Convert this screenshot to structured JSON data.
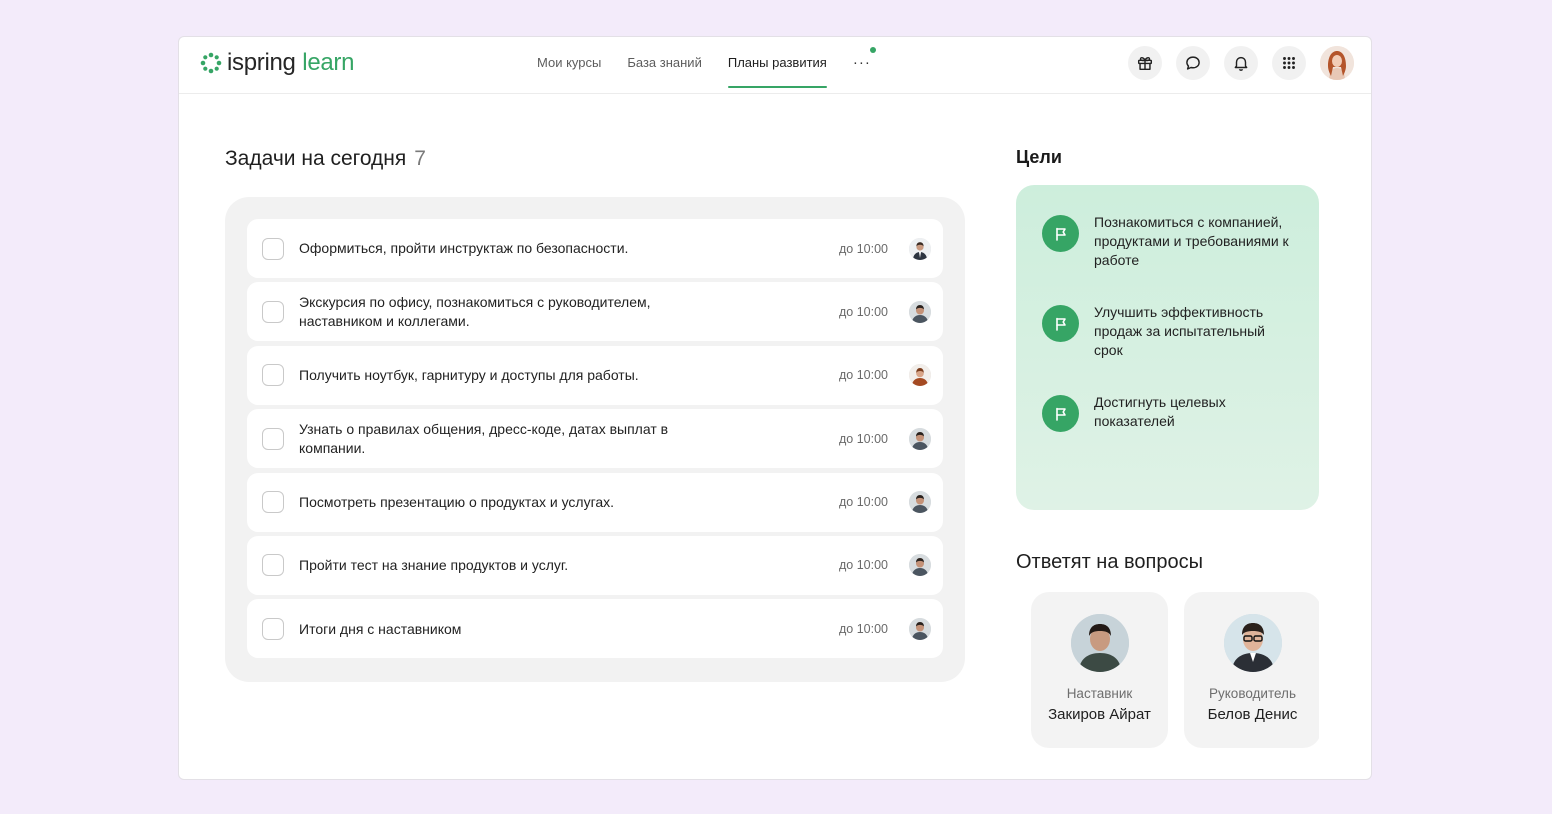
{
  "brand": {
    "word1": "ispring",
    "word2": "learn"
  },
  "nav": {
    "items": [
      "Мои курсы",
      "База знаний",
      "Планы развития"
    ],
    "active_index": 2,
    "more_label": "···"
  },
  "header_icons": [
    "gift-icon",
    "chat-icon",
    "bell-icon",
    "apps-grid-icon"
  ],
  "tasks": {
    "title": "Задачи на сегодня",
    "count": "7",
    "items": [
      {
        "text": "Оформиться, пройти инструктаж по безопасности.",
        "due": "до 10:00"
      },
      {
        "text": "Экскурсия по офису, познакомиться с руководителем, наставником и коллегами.",
        "due": "до 10:00"
      },
      {
        "text": "Получить ноутбук, гарнитуру и доступы для работы.",
        "due": "до 10:00"
      },
      {
        "text": "Узнать о правилах общения, дресс-коде, датах выплат в компании.",
        "due": "до 10:00"
      },
      {
        "text": "Посмотреть презентацию о продуктах и услугах.",
        "due": "до 10:00"
      },
      {
        "text": "Пройти тест на знание продуктов и услуг.",
        "due": "до 10:00"
      },
      {
        "text": "Итоги дня с наставником",
        "due": "до 10:00"
      }
    ]
  },
  "goals": {
    "title": "Цели",
    "items": [
      "Познакомиться с компанией, продуктами и требованиями к работе",
      "Улучшить эффективность продаж за испытательный срок",
      "Достигнуть целевых показателей"
    ]
  },
  "contacts": {
    "title": "Ответят на вопросы",
    "people": [
      {
        "role": "Наставник",
        "name": "Закиров Айрат"
      },
      {
        "role": "Руководитель",
        "name": "Белов Денис"
      }
    ]
  },
  "colors": {
    "accent": "#36a565",
    "page_bg": "#f3ebfa",
    "goals_bg": "#d6f0e0"
  }
}
